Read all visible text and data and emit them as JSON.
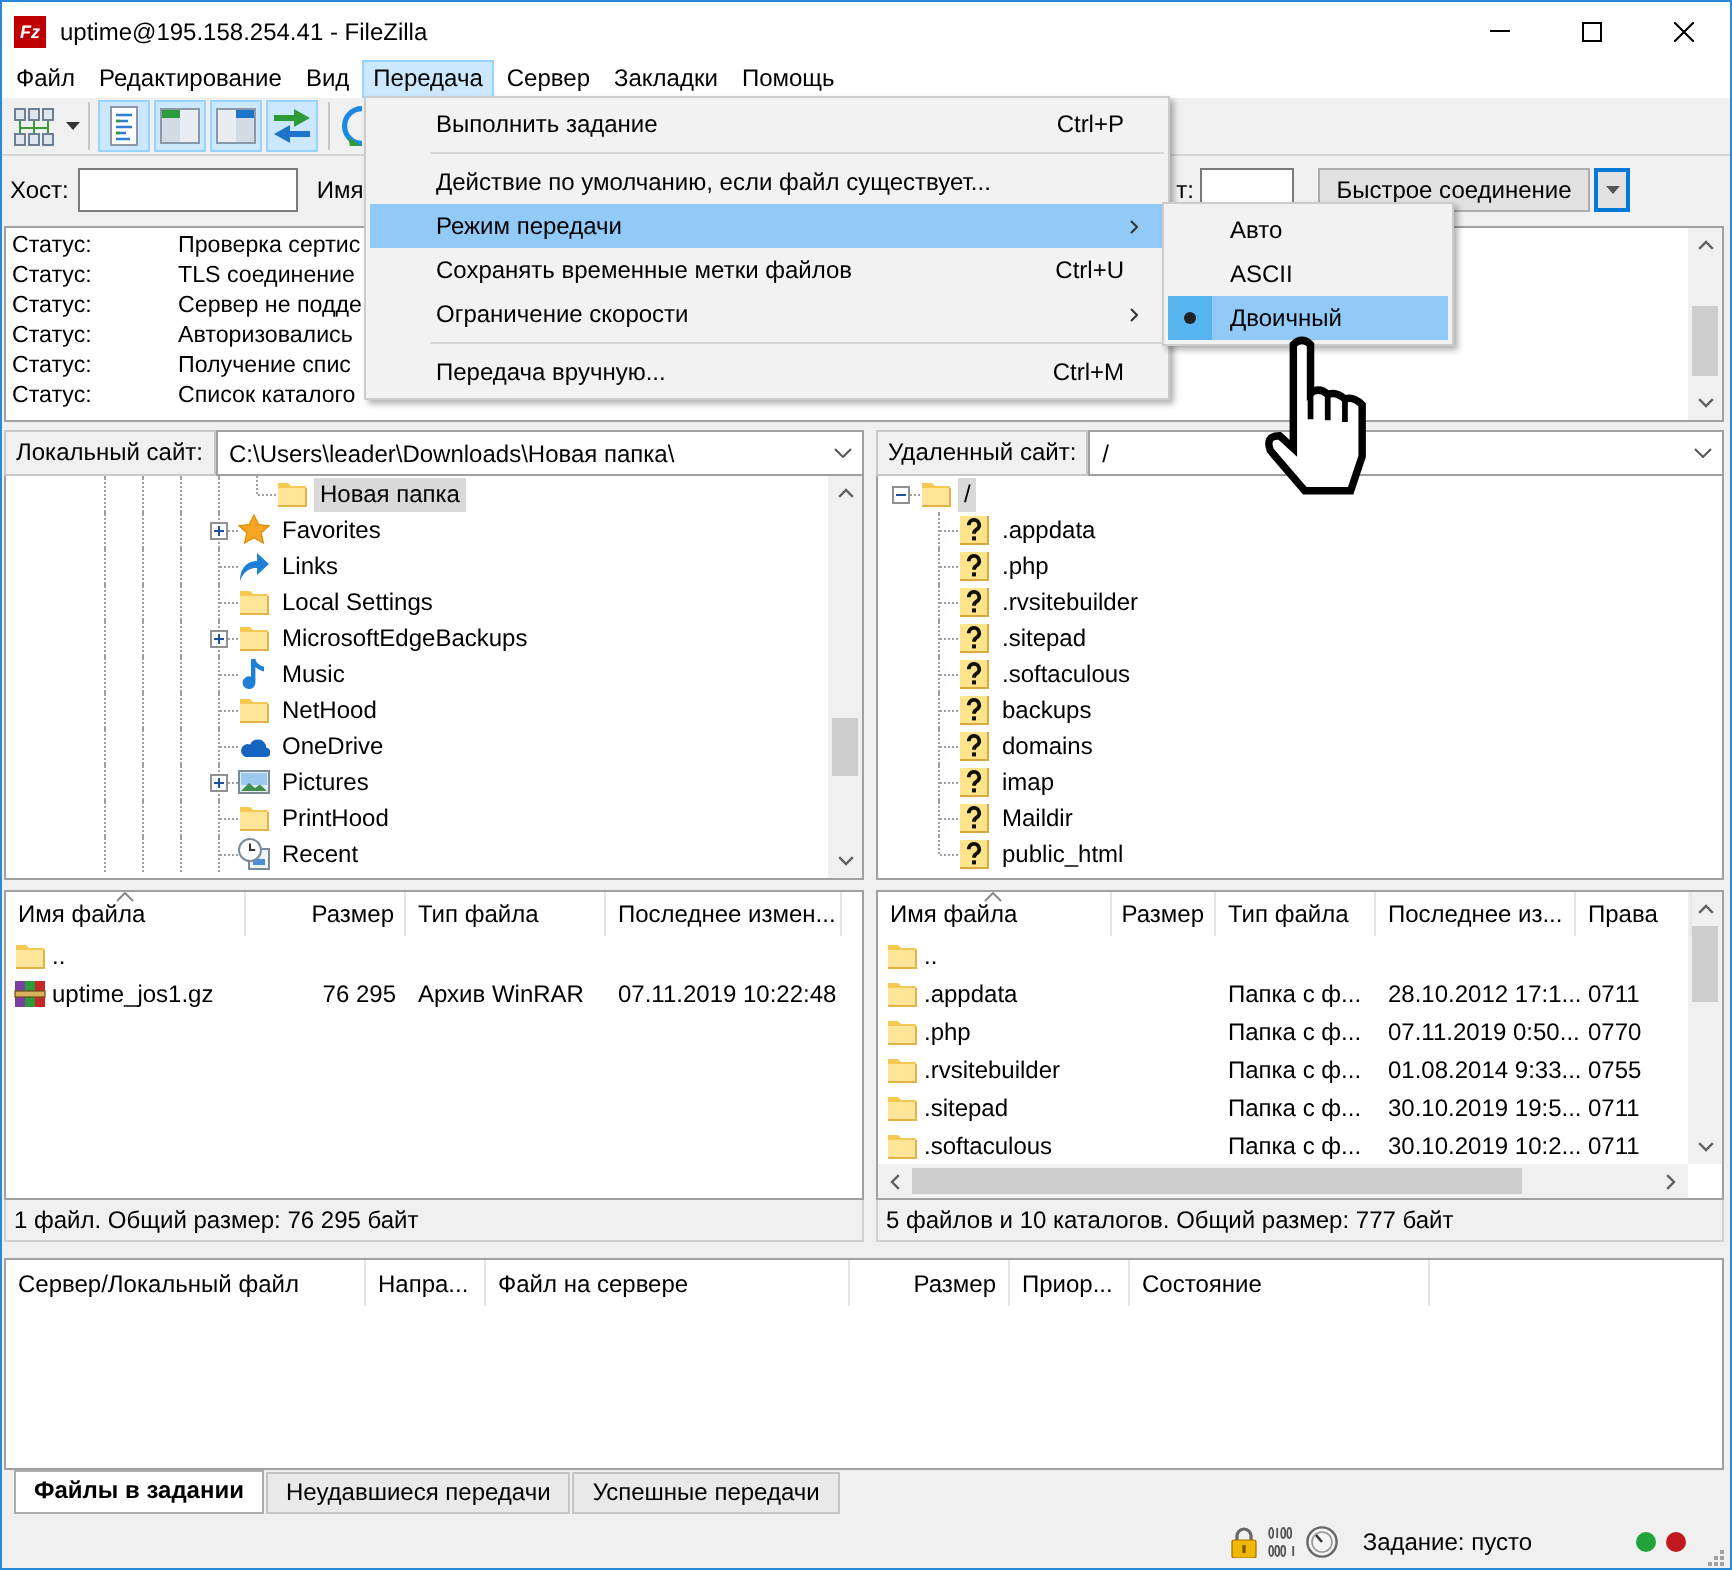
{
  "window": {
    "logo": "Fz",
    "title": "uptime@195.158.254.41 - FileZilla"
  },
  "menu_bar": [
    {
      "label": "Файл",
      "selected": false
    },
    {
      "label": "Редактирование",
      "selected": false
    },
    {
      "label": "Вид",
      "selected": false
    },
    {
      "label": "Передача",
      "selected": true
    },
    {
      "label": "Сервер",
      "selected": false
    },
    {
      "label": "Закладки",
      "selected": false
    },
    {
      "label": "Помощь",
      "selected": false
    }
  ],
  "toolbar": [
    [
      {
        "kind": "site_manager",
        "on": false
      }
    ],
    [
      {
        "kind": "message_log",
        "on": true
      },
      {
        "kind": "local_tree",
        "on": true
      },
      {
        "kind": "remote_tree",
        "on": true
      },
      {
        "kind": "queue",
        "on": true
      }
    ],
    [
      {
        "kind": "refresh",
        "on": false
      }
    ]
  ],
  "quickconnect": {
    "host_label": "Хост:",
    "user_label": "Имя",
    "port_label": "т:",
    "connect_button": "Быстрое соединение"
  },
  "message_log": [
    {
      "type": "Статус:",
      "message": "Проверка сертис"
    },
    {
      "type": "Статус:",
      "message": "TLS соединение"
    },
    {
      "type": "Статус:",
      "message": "Сервер не подде"
    },
    {
      "type": "Статус:",
      "message": "Авторизовались"
    },
    {
      "type": "Статус:",
      "message": "Получение спис"
    },
    {
      "type": "Статус:",
      "message": "Список каталого"
    }
  ],
  "transfer_menu": [
    {
      "kind": "command",
      "label": "Выполнить задание",
      "shortcut": "Ctrl+P",
      "selected": false
    },
    {
      "kind": "separator"
    },
    {
      "kind": "command",
      "label": "Действие по умолчанию, если файл существует...",
      "selected": false
    },
    {
      "kind": "submenu",
      "label": "Режим передачи",
      "selected": true
    },
    {
      "kind": "command",
      "label": "Сохранять временные метки файлов",
      "shortcut": "Ctrl+U",
      "selected": false
    },
    {
      "kind": "submenu",
      "label": "Ограничение скорости",
      "selected": false
    },
    {
      "kind": "separator"
    },
    {
      "kind": "command",
      "label": "Передача вручную...",
      "shortcut": "Ctrl+M",
      "selected": false
    }
  ],
  "transfer_mode_submenu": [
    {
      "label": "Авто",
      "checked": false,
      "selected": false
    },
    {
      "label": "ASCII",
      "checked": false,
      "selected": false
    },
    {
      "label": "Двоичный",
      "checked": true,
      "selected": true
    }
  ],
  "local_site": {
    "label": "Локальный сайт:",
    "path": "C:\\Users\\leader\\Downloads\\Новая папка\\",
    "tree": [
      {
        "children": [
          {
            "label": "Новая папка",
            "kind": "folder",
            "selected": true
          }
        ]
      },
      {
        "label": "Favorites",
        "kind": "favorites",
        "expanded": false,
        "selected": false
      },
      {
        "label": "Links",
        "kind": "links",
        "selected": false
      },
      {
        "label": "Local Settings",
        "kind": "folder",
        "selected": false
      },
      {
        "label": "MicrosoftEdgeBackups",
        "kind": "folder",
        "expanded": false,
        "selected": false
      },
      {
        "label": "Music",
        "kind": "music",
        "selected": false
      },
      {
        "label": "NetHood",
        "kind": "folder",
        "selected": false
      },
      {
        "label": "OneDrive",
        "kind": "onedrive",
        "selected": false
      },
      {
        "label": "Pictures",
        "kind": "pictures",
        "expanded": false,
        "selected": false
      },
      {
        "label": "PrintHood",
        "kind": "folder",
        "selected": false
      },
      {
        "label": "Recent",
        "kind": "recent",
        "selected": false
      }
    ]
  },
  "remote_site": {
    "label": "Удаленный сайт:",
    "path": "/",
    "tree": [
      {
        "label": "/",
        "kind": "folder",
        "expanded": true,
        "selected": true,
        "children": [
          {
            "label": ".appdata",
            "kind": "unknown",
            "selected": false
          },
          {
            "label": ".php",
            "kind": "unknown",
            "selected": false
          },
          {
            "label": ".rvsitebuilder",
            "kind": "unknown",
            "selected": false
          },
          {
            "label": ".sitepad",
            "kind": "unknown",
            "selected": false
          },
          {
            "label": ".softaculous",
            "kind": "unknown",
            "selected": false
          },
          {
            "label": "backups",
            "kind": "unknown",
            "selected": false
          },
          {
            "label": "domains",
            "kind": "unknown",
            "selected": false
          },
          {
            "label": "imap",
            "kind": "unknown",
            "selected": false
          },
          {
            "label": "Maildir",
            "kind": "unknown",
            "selected": false
          },
          {
            "label": "public_html",
            "kind": "unknown",
            "selected": false
          }
        ]
      }
    ]
  },
  "local_files": {
    "columns": [
      {
        "label": "Имя файла",
        "sorted": true
      },
      {
        "label": "Размер",
        "sorted": false
      },
      {
        "label": "Тип файла",
        "sorted": false
      },
      {
        "label": "Последнее измен...",
        "sorted": false
      }
    ],
    "rows": [
      {
        "kind": "folder",
        "name": ".."
      },
      {
        "kind": "archive",
        "name": "uptime_jos1.gz",
        "size": "76 295",
        "type": "Архив WinRAR",
        "modified": "07.11.2019 10:22:48"
      }
    ],
    "status": "1 файл. Общий размер: 76 295 байт"
  },
  "remote_files": {
    "columns": [
      {
        "label": "Имя файла",
        "sorted": true
      },
      {
        "label": "Размер",
        "sorted": false
      },
      {
        "label": "Тип файла",
        "sorted": false
      },
      {
        "label": "Последнее из...",
        "sorted": false
      },
      {
        "label": "Права",
        "sorted": false
      }
    ],
    "rows": [
      {
        "kind": "folder",
        "name": ".."
      },
      {
        "kind": "folder",
        "name": ".appdata",
        "type": "Папка с ф...",
        "modified": "28.10.2012 17:1...",
        "permissions": "0711"
      },
      {
        "kind": "folder",
        "name": ".php",
        "type": "Папка с ф...",
        "modified": "07.11.2019 0:50...",
        "permissions": "0770"
      },
      {
        "kind": "folder",
        "name": ".rvsitebuilder",
        "type": "Папка с ф...",
        "modified": "01.08.2014 9:33...",
        "permissions": "0755"
      },
      {
        "kind": "folder",
        "name": ".sitepad",
        "type": "Папка с ф...",
        "modified": "30.10.2019 19:5...",
        "permissions": "0711"
      },
      {
        "kind": "folder",
        "name": ".softaculous",
        "type": "Папка с ф...",
        "modified": "30.10.2019 10:2...",
        "permissions": "0711"
      }
    ],
    "status": "5 файлов и 10 каталогов. Общий размер: 777 байт"
  },
  "queue": {
    "columns": [
      "Сервер/Локальный файл",
      "Напра...",
      "Файл на сервере",
      "Размер",
      "Приор...",
      "Состояние"
    ],
    "tabs": [
      {
        "label": "Файлы в задании",
        "selected": true
      },
      {
        "label": "Неудавшиеся передачи",
        "selected": false
      },
      {
        "label": "Успешные передачи",
        "selected": false
      }
    ]
  },
  "status_bar": {
    "text": "Задание: пусто",
    "indicators": [
      {
        "color": "#22a33a"
      },
      {
        "color": "#c0181e"
      }
    ]
  }
}
